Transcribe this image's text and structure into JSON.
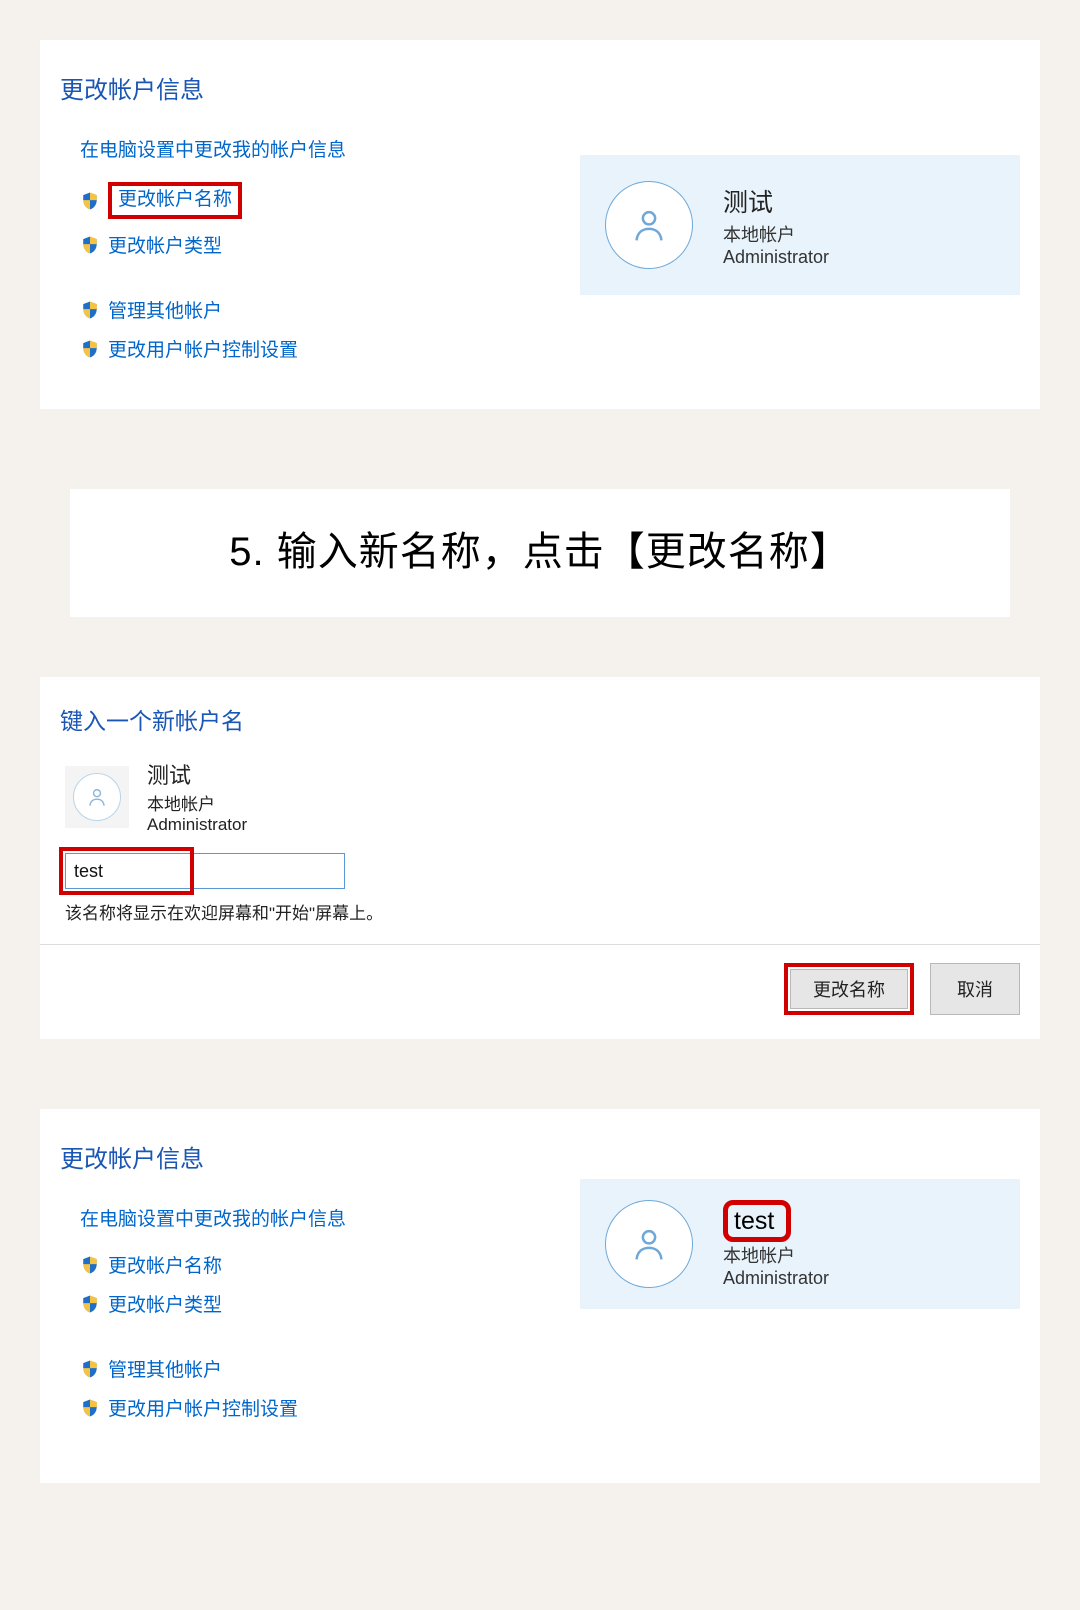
{
  "panel1": {
    "title": "更改帐户信息",
    "settings_link": "在电脑设置中更改我的帐户信息",
    "change_name": "更改帐户名称",
    "change_type": "更改帐户类型",
    "manage_other": "管理其他帐户",
    "change_uac": "更改用户帐户控制设置",
    "user": {
      "name": "测试",
      "type": "本地帐户",
      "role": "Administrator"
    }
  },
  "instruction": "5. 输入新名称，点击【更改名称】",
  "panel2": {
    "title": "键入一个新帐户名",
    "user": {
      "name": "测试",
      "type": "本地帐户",
      "role": "Administrator"
    },
    "input_value": "test",
    "hint": "该名称将显示在欢迎屏幕和\"开始\"屏幕上。",
    "save_btn": "更改名称",
    "cancel_btn": "取消"
  },
  "panel3": {
    "title": "更改帐户信息",
    "settings_link": "在电脑设置中更改我的帐户信息",
    "change_name": "更改帐户名称",
    "change_type": "更改帐户类型",
    "manage_other": "管理其他帐户",
    "change_uac": "更改用户帐户控制设置",
    "user": {
      "name": "test",
      "type": "本地帐户",
      "role": "Administrator"
    }
  }
}
